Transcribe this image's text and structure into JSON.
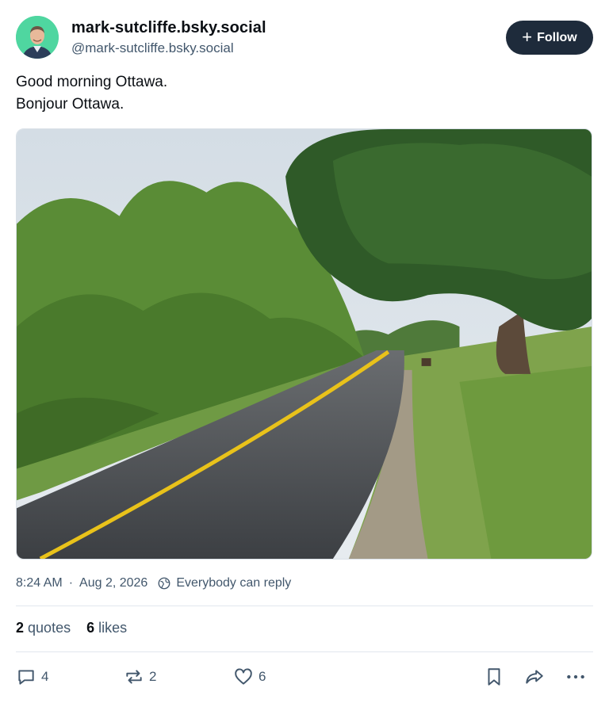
{
  "author": {
    "display_name": "mark-sutcliffe.bsky.social",
    "handle": "@mark-sutcliffe.bsky.social",
    "avatar_icon": "avatar-photo"
  },
  "follow": {
    "label": "Follow",
    "icon": "plus-icon"
  },
  "post": {
    "lines": [
      "Good morning Ottawa.",
      "Bonjour Ottawa."
    ],
    "image_icon": "park-path-photo"
  },
  "meta": {
    "time": "8:24 AM",
    "separator": "·",
    "date": "Aug 2, 2026",
    "reply_setting": "Everybody can reply"
  },
  "stats": {
    "quotes_count": "2",
    "quotes_label": "quotes",
    "likes_count": "6",
    "likes_label": "likes"
  },
  "actions": {
    "reply_count": "4",
    "repost_count": "2",
    "like_count": "6"
  },
  "colors": {
    "follow_bg": "#1e2b3b",
    "muted_text": "#42576c",
    "primary_text": "#0b0f14",
    "divider": "#e1e7ee"
  }
}
